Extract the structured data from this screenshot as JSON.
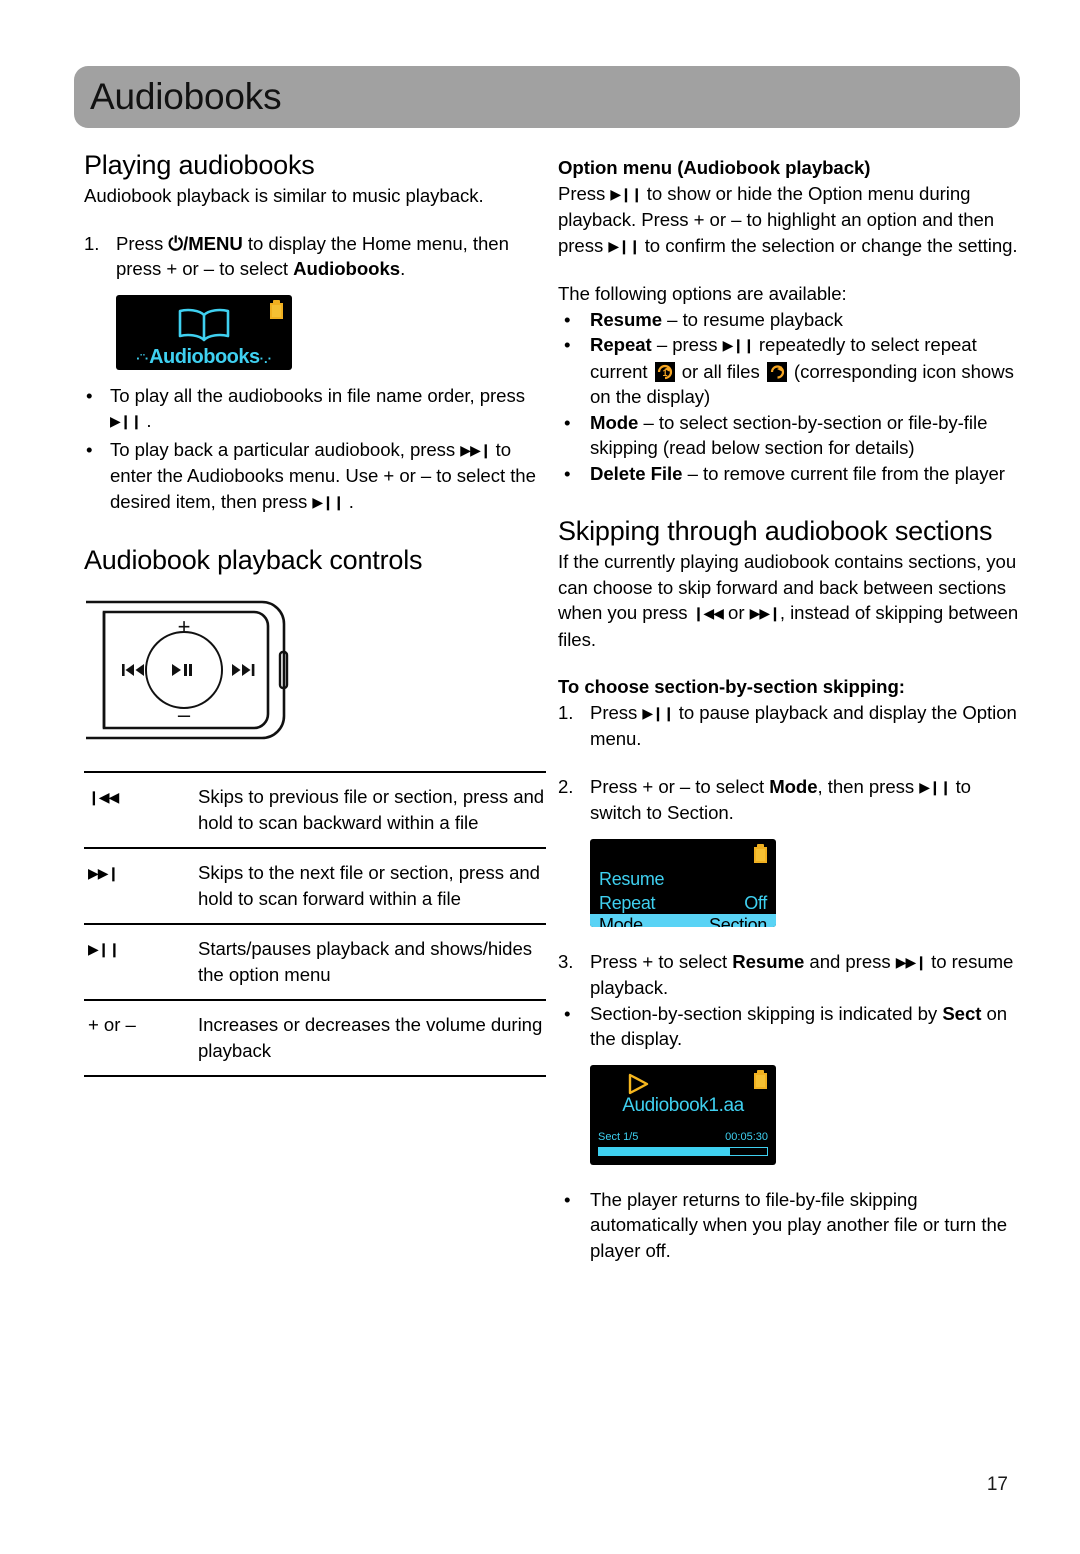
{
  "page": {
    "header_title": "Audiobooks",
    "page_number": "17"
  },
  "colors": {
    "header_gray": "#a1a1a1",
    "screen_cyan": "#3fd0f0",
    "screen_highlight": "#59d3f5",
    "battery_yellow": "#f5c033",
    "repeat_icon_orange": "#f5a623",
    "screen_black": "#000000"
  },
  "left": {
    "playing_title": "Playing audiobooks",
    "playing_intro": "Audiobook playback is similar to music playback.",
    "step1": {
      "marker": "1.",
      "text_a": "Press ",
      "power_menu": "/MENU",
      "text_b": " to display the Home menu, then press + or – to select ",
      "bold_target": "Audiobooks",
      "text_c": "."
    },
    "home_screen": {
      "label": "Audiobooks",
      "dots_left": "·¨·",
      "dots_right": "·.·",
      "battery_icon": "battery-icon",
      "book_icon": "open-book-icon"
    },
    "bullets": [
      {
        "marker": "•",
        "parts": [
          "To play all the audiobooks in file name order, press ",
          "▶❙❙",
          " ."
        ]
      },
      {
        "marker": "•",
        "parts": [
          "To play back a particular audiobook, press ",
          "▶▶❙",
          " to enter the Audiobooks menu. Use + or – to select the desired item, then press ",
          "▶❙❙",
          " ."
        ]
      }
    ],
    "controls_title": "Audiobook playback controls",
    "device_diagram": {
      "plus_label": "+",
      "minus_label": "–",
      "prev_label": "❙◀◀",
      "play_label": "▶❙❙",
      "next_label": "▶▶❙",
      "side_button": "side-button"
    },
    "controls_table": [
      {
        "key": "❙◀◀",
        "key_name": "previous-track-icon",
        "desc": "Skips to previous file or section, press and hold to scan backward within a file"
      },
      {
        "key": "▶▶❙",
        "key_name": "next-track-icon",
        "desc": "Skips to the next file or section, press and hold to scan forward within a file"
      },
      {
        "key": "▶❙❙",
        "key_name": "play-pause-icon",
        "desc": "Starts/pauses playback and shows/hides the option menu"
      },
      {
        "key": "+ or –",
        "key_name": "volume-keys",
        "desc": "Increases or decreases the volume during playback"
      }
    ]
  },
  "right": {
    "option_menu_title": "Option menu (Audiobook playback)",
    "option_menu_para_1": "Press ",
    "option_menu_para_2": " to show or hide the Option menu during playback. Press + or – to highlight an option and then press ",
    "option_menu_para_3": " to confirm the selection or change the setting.",
    "available_intro": "The following options are available:",
    "options": [
      {
        "marker": "•",
        "bold": "Resume",
        "rest": " – to resume playback"
      },
      {
        "marker": "•",
        "bold": "Repeat",
        "rest_a": " – press ",
        "glyph": "▶❙❙",
        "rest_b": " repeatedly to select repeat current ",
        "icon_one": "repeat-one-icon",
        "rest_c": " or all files ",
        "icon_all": "repeat-all-icon",
        "rest_d": " (corresponding icon shows on the display)"
      },
      {
        "marker": "•",
        "bold": "Mode",
        "rest": " – to select section-by-section or file-by-file skipping (read below section for details)"
      },
      {
        "marker": "•",
        "bold": "Delete File",
        "rest": " – to remove current file from the player"
      }
    ],
    "skipping_title": "Skipping through audiobook sections",
    "skipping_para_a": "If the currently playing audiobook contains sections, you can choose to skip forward and back between sections when you press ",
    "skipping_glyph_prev": "❙◀◀",
    "skipping_para_b": " or ",
    "skipping_glyph_next": "▶▶❙",
    "skipping_para_c": ", instead of skipping between files.",
    "choose_title": "To choose section-by-section skipping:",
    "steps": [
      {
        "marker": "1.",
        "text_a": "Press ",
        "glyph": "▶❙❙",
        "text_b": " to pause playback and display the Option menu."
      },
      {
        "marker": "2.",
        "text_a": "Press + or – to select ",
        "bold": "Mode",
        "text_b": ", then press ",
        "glyph": "▶❙❙",
        "text_c": " to switch to Section."
      },
      {
        "marker": "3.",
        "text_a": "Press + to select ",
        "bold": "Resume",
        "text_b": " and press ",
        "glyph": "▶▶❙",
        "text_c": " to resume playback."
      }
    ],
    "option_screen": {
      "rows": [
        {
          "label": "Resume",
          "value": ""
        },
        {
          "label": "Repeat",
          "value": "Off"
        },
        {
          "label": "Mode",
          "value": "Section"
        }
      ],
      "selected_index": 2,
      "battery_icon": "battery-icon"
    },
    "sect_bullet": {
      "marker": "•",
      "text_a": "Section-by-section skipping is indicated by ",
      "bold": "Sect",
      "text_b": " on the display."
    },
    "play_screen": {
      "track": "Audiobook1.aa",
      "section": "Sect 1/5",
      "time": "00:05:30",
      "progress_percent": 78,
      "play_icon": "play-triangle-icon",
      "battery_icon": "battery-icon"
    },
    "final_bullet": {
      "marker": "•",
      "text": "The player returns to file-by-file skipping automatically when you play another file or turn the player off."
    }
  }
}
